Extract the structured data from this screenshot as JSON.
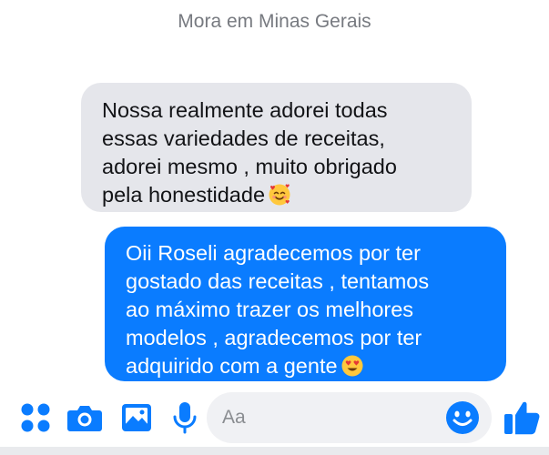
{
  "conversation": {
    "context_line": "Mora em Minas Gerais",
    "received_message": {
      "lines": [
        "Nossa realmente adorei todas",
        "essas variedades de receitas,",
        "adorei mesmo , muito obrigado",
        "pela honestidade"
      ],
      "emoji": "smiling-face-with-hearts"
    },
    "sent_message": {
      "lines": [
        "Oii Roseli agradecemos por ter",
        "gostado das receitas , tentamos",
        "ao máximo trazer os melhores",
        "modelos , agradecemos por ter",
        "adquirido com a gente"
      ],
      "emoji": "heart-eyes-face"
    }
  },
  "composer": {
    "placeholder": "Aa",
    "icons": [
      "menu-dots-icon",
      "camera-icon",
      "gallery-icon",
      "microphone-icon",
      "emoji-icon",
      "thumbs-up-icon"
    ]
  },
  "colors": {
    "accent": "#0a7cff",
    "received_bubble": "#e5e6eb",
    "emoji_yellow": "#ffc83d"
  }
}
